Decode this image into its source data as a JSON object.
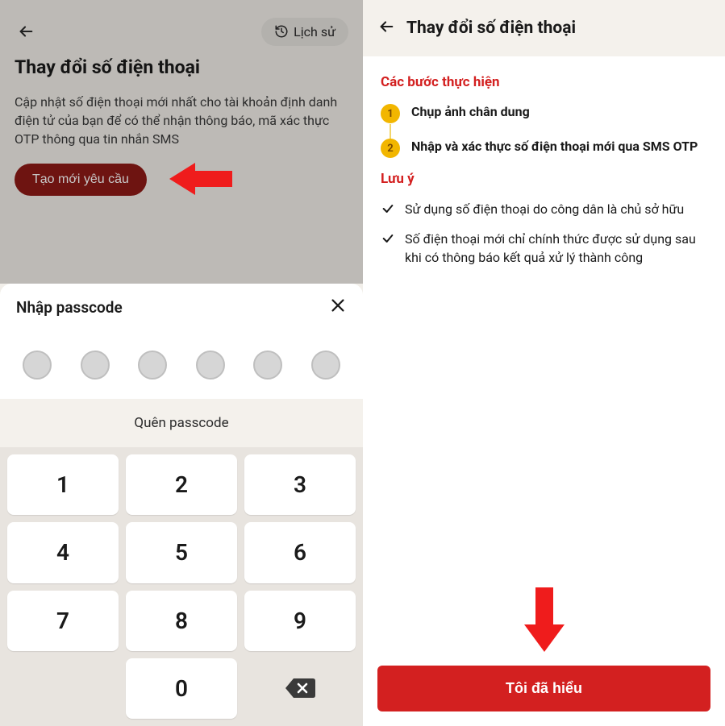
{
  "left": {
    "history_label": "Lịch sử",
    "title": "Thay đổi số điện thoại",
    "description": "Cập nhật số điện thoại mới nhất cho tài khoản định danh điện tử của bạn để có thể nhận thông báo, mã xác thực OTP thông qua tin nhắn SMS",
    "create_button": "Tạo mới yêu cầu",
    "sheet_title": "Nhập passcode",
    "forgot_label": "Quên passcode",
    "keys": {
      "k1": "1",
      "k2": "2",
      "k3": "3",
      "k4": "4",
      "k5": "5",
      "k6": "6",
      "k7": "7",
      "k8": "8",
      "k9": "9",
      "k0": "0"
    }
  },
  "right": {
    "title": "Thay đổi số điện thoại",
    "steps_title": "Các bước thực hiện",
    "steps": [
      {
        "num": "1",
        "text": "Chụp ảnh chân dung"
      },
      {
        "num": "2",
        "text": "Nhập và xác thực số điện thoại mới qua SMS OTP"
      }
    ],
    "notes_title": "Lưu ý",
    "notes": [
      "Sử dụng số điện thoại do công dân là chủ sở hữu",
      "Số điện thoại mới chỉ chính thức được sử dụng sau khi có thông báo kết quả xử lý thành công"
    ],
    "confirm_button": "Tôi đã hiểu"
  }
}
